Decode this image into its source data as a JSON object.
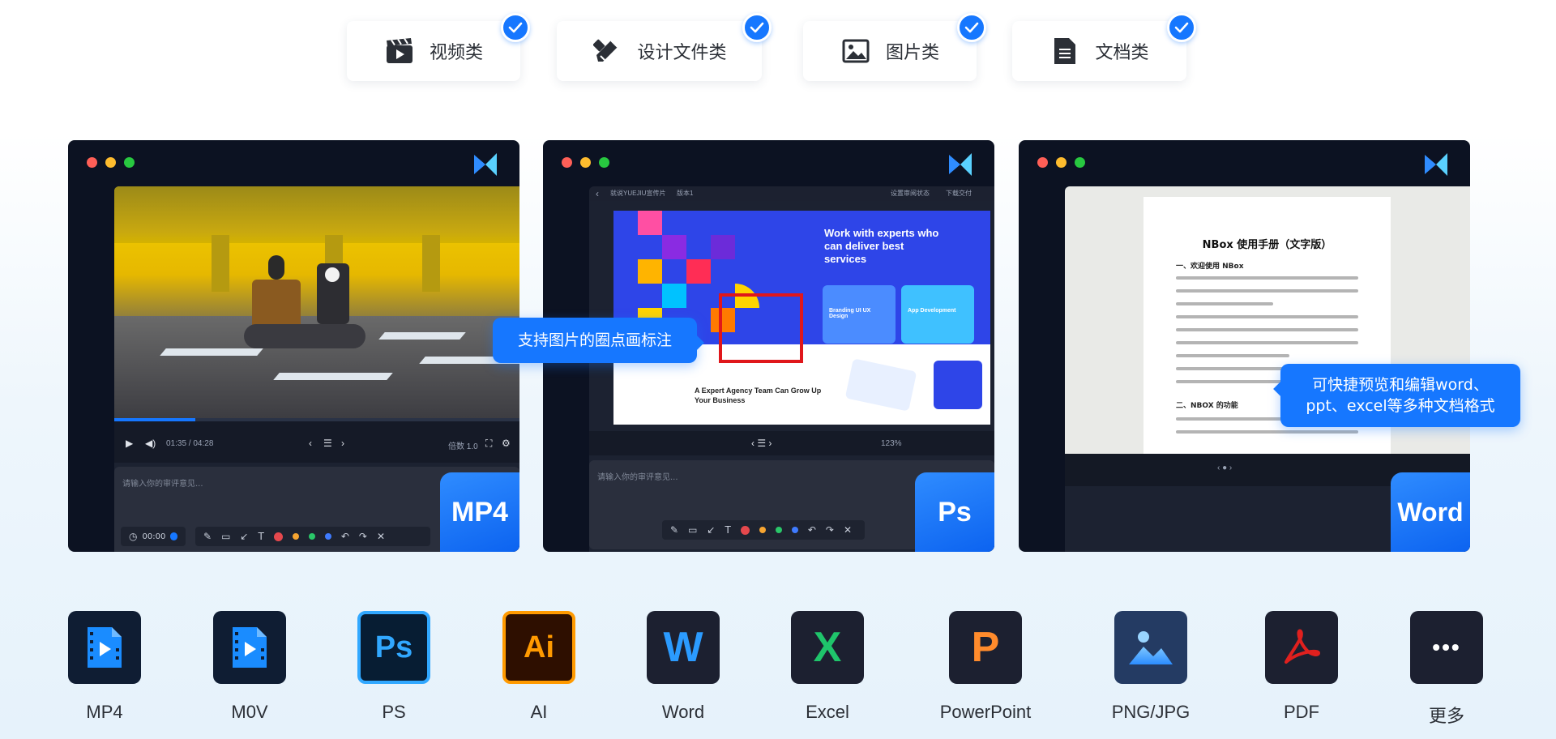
{
  "tabs": [
    {
      "label": "视频类",
      "icon": "clapperboard-icon",
      "checked": true
    },
    {
      "label": "设计文件类",
      "icon": "design-tools-icon",
      "checked": true
    },
    {
      "label": "图片类",
      "icon": "image-icon",
      "checked": true
    },
    {
      "label": "文档类",
      "icon": "document-icon",
      "checked": true
    }
  ],
  "windows": {
    "video": {
      "badge": "MP4",
      "time": "01:35 / 04:28",
      "speed": "倍数 1.0",
      "comment_placeholder": "请输入你的审评意见...",
      "timestamp": "00:00"
    },
    "ps": {
      "badge": "Ps",
      "breadcrumb": "就说YUEJIU宣传片",
      "version": "版本1",
      "status": "设置审阅状态",
      "download": "下载交付",
      "heading": "Work with experts who can deliver best services",
      "card1": "Branding UI UX Design",
      "card2": "App Development",
      "subheading": "A Expert Agency Team Can Grow Up Your Business",
      "zoom": "123%",
      "comment_placeholder": "请输入你的审评意见..."
    },
    "word": {
      "badge": "Word",
      "doc_title": "NBox 使用手册（文字版）",
      "section1": "一、欢迎使用 NBox",
      "section2": "二、NBOX 的功能"
    }
  },
  "callouts": {
    "image_annotation": "支持图片的圈点画标注",
    "doc_preview": "可快捷预览和编辑word、ppt、excel等多种文档格式"
  },
  "formats": [
    {
      "label": "MP4",
      "icon": "mp4-file-icon",
      "glyph": ""
    },
    {
      "label": "M0V",
      "icon": "mov-file-icon",
      "glyph": ""
    },
    {
      "label": "PS",
      "icon": "photoshop-icon",
      "glyph": "Ps"
    },
    {
      "label": "AI",
      "icon": "illustrator-icon",
      "glyph": "Ai"
    },
    {
      "label": "Word",
      "icon": "word-icon",
      "glyph": "W"
    },
    {
      "label": "Excel",
      "icon": "excel-icon",
      "glyph": "X"
    },
    {
      "label": "PowerPoint",
      "icon": "powerpoint-icon",
      "glyph": "P"
    },
    {
      "label": "PNG/JPG",
      "icon": "image-file-icon",
      "glyph": ""
    },
    {
      "label": "PDF",
      "icon": "pdf-icon",
      "glyph": ""
    },
    {
      "label": "更多",
      "icon": "more-icon",
      "glyph": "•••"
    }
  ],
  "colors": {
    "accent": "#1677ff",
    "window_bg": "#0c1222",
    "ps_border": "#31a8ff",
    "ai_border": "#ff9a00",
    "word_blue": "#2b9bff",
    "excel_green": "#1fc46b",
    "ppt_orange": "#ff8b2c",
    "pdf_red": "#e0201e"
  }
}
